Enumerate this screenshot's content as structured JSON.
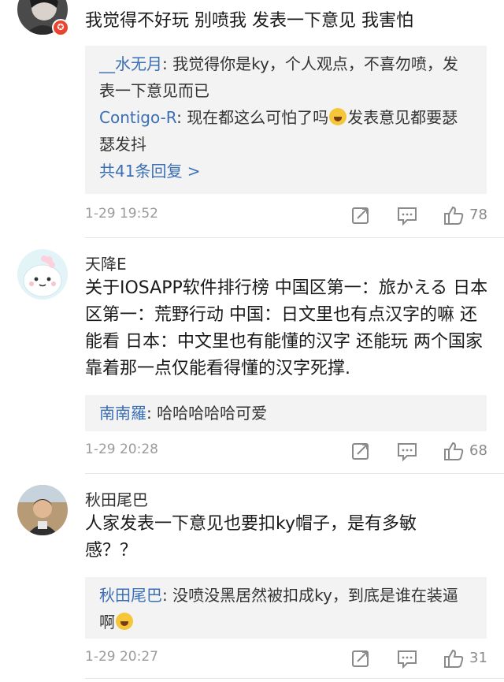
{
  "comments": [
    {
      "username": "",
      "content": "我觉得不好玩 别喷我 发表一下意见  我害怕",
      "replies": [
        {
          "name": "__水无月",
          "sep": ": ",
          "text": "我觉得你是ky，个人观点，不喜勿喷，发表一下意见而已"
        },
        {
          "name": "Contigo-R",
          "sep": ": ",
          "text_a": "现在都这么可怕了吗",
          "text_b": "发表意见都要瑟瑟发抖"
        }
      ],
      "more": "共41条回复 >",
      "time": "1-29 19:52",
      "likes": "78",
      "avatar_colors": [
        "#3b3b3b",
        "#e8e8e8"
      ]
    },
    {
      "username": "天降E",
      "content": "关于IOSAPP软件排行榜 中国区第一：旅かえる 日本区第一：荒野行动 中国：日文里也有点汉字的嘛 还能看 日本：中文里也有能懂的汉字 还能玩 两个国家靠着那一点仅能看得懂的汉字死撑.",
      "replies": [
        {
          "name": "南南羅",
          "sep": ": ",
          "text": "哈哈哈哈哈可爱"
        }
      ],
      "time": "1-29 20:28",
      "likes": "68",
      "avatar_colors": [
        "#dff3f7",
        "#ffffff"
      ]
    },
    {
      "username": "秋田尾巴",
      "content": "人家发表一下意见也要扣ky帽子，是有多敏感？？",
      "replies": [
        {
          "name": "秋田尾巴",
          "sep": ": ",
          "text": "没喷没黑居然被扣成ky，到底是谁在装逼啊"
        }
      ],
      "time": "1-29 20:27",
      "likes": "31",
      "avatar_colors": [
        "#8a6a4a",
        "#d9c3a3"
      ]
    }
  ],
  "icons": {
    "repost": "repost-icon",
    "comment": "comment-icon",
    "like": "like-icon",
    "verified": "verified-badge-icon"
  },
  "colors": {
    "link": "#3a6fb5",
    "reply_bg": "#f3f3f3",
    "meta": "#9b9b9b",
    "badge": "#e8442e"
  }
}
